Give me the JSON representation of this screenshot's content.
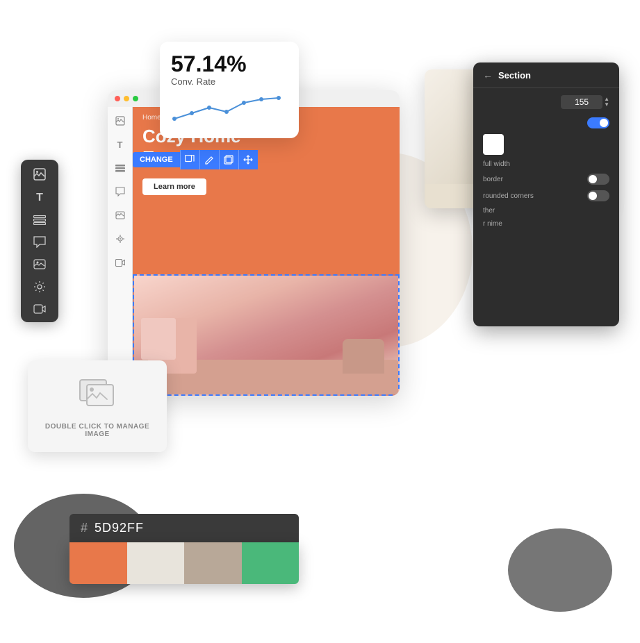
{
  "analytics": {
    "percent": "57.14%",
    "label": "Conv. Rate"
  },
  "hero": {
    "brand": "Home&calm",
    "title_line1": "Cozy Home",
    "title_line2": "Essentials",
    "button_label": "Learn more"
  },
  "change_toolbar": {
    "label": "CHANGE"
  },
  "settings_panel": {
    "title": "Section",
    "number_value": "155",
    "labels": {
      "full_width": "full width",
      "border": "border",
      "rounded_corners": "rounded corners",
      "other1": "ther",
      "other2": "r nime"
    }
  },
  "image_manager": {
    "text": "DOUBLE CLICK TO MANAGE IMAGE"
  },
  "color_picker": {
    "hash": "#",
    "hex_value": "5D92FF",
    "swatches": [
      {
        "color": "#E8784A",
        "name": "orange"
      },
      {
        "color": "#e8e4dc",
        "name": "light-gray"
      },
      {
        "color": "#b8a898",
        "name": "warm-gray"
      },
      {
        "color": "#4ab87a",
        "name": "green"
      }
    ]
  },
  "icons": {
    "back_arrow": "←",
    "plus": "+",
    "image": "🖼",
    "text": "T",
    "layout": "☰",
    "comment": "💬",
    "photo": "🏔",
    "settings": "⚙",
    "video": "▶",
    "copy": "⧉",
    "edit": "✏",
    "crop": "⊡",
    "move": "⤢"
  }
}
